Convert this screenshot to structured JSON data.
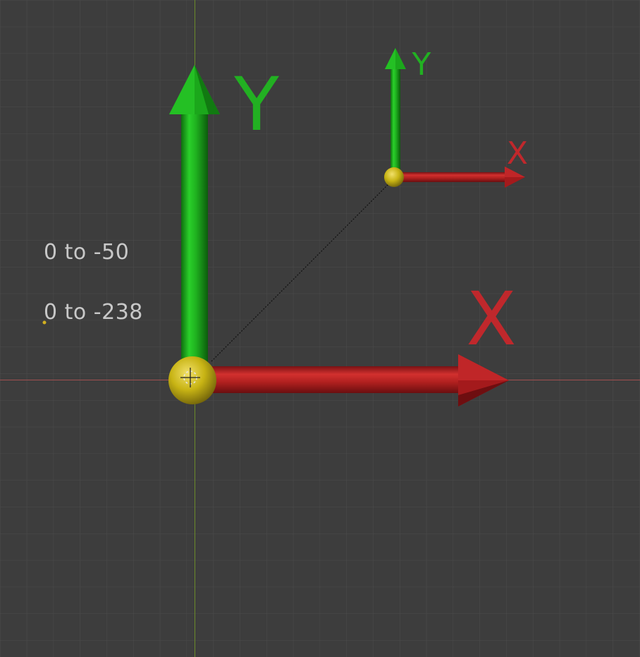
{
  "viewport": {
    "background": "#3d3d3d",
    "grid_color": "#4a4a4a",
    "x_axis_line_color": "#a05050",
    "y_axis_line_color": "#6a8a2a"
  },
  "overlay": {
    "line_1": "0 to -50",
    "line_2": "0 to -238"
  },
  "gizmo_large": {
    "x_label": "X",
    "y_label": "Y",
    "x_color": "#c0282c",
    "y_color": "#22b022",
    "origin_color": "#c8b414",
    "icons": [
      "origin-sphere-icon",
      "x-axis-arrow-icon",
      "y-axis-arrow-icon",
      "cursor-crosshair-icon"
    ]
  },
  "gizmo_small": {
    "x_label": "X",
    "y_label": "Y",
    "x_color": "#c0282c",
    "y_color": "#22b022",
    "origin_color": "#c8b414",
    "icons": [
      "origin-sphere-icon",
      "x-axis-arrow-icon",
      "y-axis-arrow-icon"
    ]
  }
}
